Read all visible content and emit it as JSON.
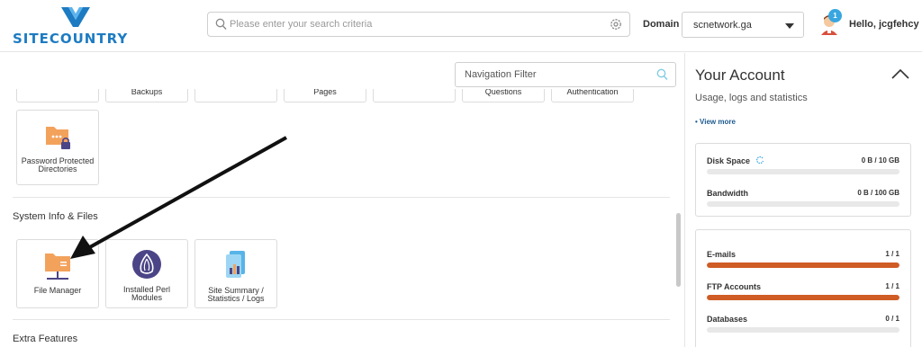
{
  "header": {
    "logo_text": "SITECOUNTRY",
    "search_placeholder": "Please enter your search criteria",
    "domain_label": "Domain",
    "domain_value": "scnetwork.ga",
    "notification_count": "1",
    "greeting": "Hello, jcgfehcy"
  },
  "main": {
    "nav_filter_placeholder": "Navigation Filter",
    "top_tile_stubs": [
      "",
      "Backups",
      "",
      "Pages",
      "",
      "Questions",
      "Authentication"
    ],
    "tiles": {
      "password_protected": "Password Protected Directories",
      "file_manager": "File Manager",
      "installed_perl": "Installed Perl Modules",
      "site_summary": "Site Summary / Statistics / Logs"
    },
    "sections": {
      "system_info": "System Info & Files",
      "extra_features": "Extra Features"
    }
  },
  "account": {
    "title": "Your Account",
    "subtitle": "Usage, logs and statistics",
    "view_more": "• View more",
    "disk_space": {
      "label": "Disk Space",
      "value": "0 B / 10 GB",
      "fraction": 0
    },
    "bandwidth": {
      "label": "Bandwidth",
      "value": "0 B / 100 GB",
      "fraction": 0
    },
    "emails": {
      "label": "E-mails",
      "value": "1 / 1",
      "fraction": 1
    },
    "ftp_accounts": {
      "label": "FTP Accounts",
      "value": "1 / 1",
      "fraction": 1
    },
    "databases": {
      "label": "Databases",
      "value": "0 / 1",
      "fraction": 0
    }
  },
  "colors": {
    "brand": "#1d7bc2",
    "usage_bar": "#cf5b25",
    "folder_orange": "#f3a25c",
    "perl_purple": "#4b4587",
    "badge_blue": "#38a6e0"
  },
  "icons": [
    "search-icon",
    "gear-icon",
    "avatar",
    "folder-lock-icon",
    "file-manager-icon",
    "perl-onion-icon",
    "site-summary-icon",
    "filter-search-icon",
    "chevron-up-icon",
    "refresh-icon"
  ]
}
